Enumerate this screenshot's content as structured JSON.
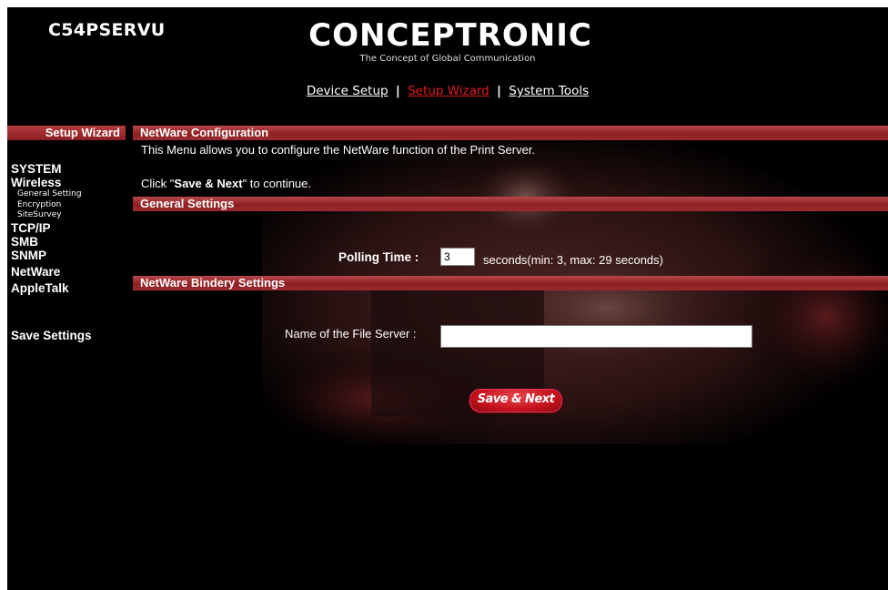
{
  "header": {
    "model": "C54PSERVU",
    "brand": "CONCEPTRONIC",
    "tagline": "The Concept of Global Communication",
    "nav": [
      {
        "label": "Device Setup",
        "active": false
      },
      {
        "label": "Setup Wizard",
        "active": true
      },
      {
        "label": "System Tools",
        "active": false
      }
    ],
    "nav_separator": "|"
  },
  "sidebar": {
    "title": "Setup Wizard",
    "items": [
      {
        "label": "SYSTEM"
      },
      {
        "label": "Wireless",
        "sub": [
          "General Setting",
          "Encryption",
          "SiteSurvey"
        ]
      },
      {
        "label": "TCP/IP"
      },
      {
        "label": "SMB"
      },
      {
        "label": "SNMP"
      },
      {
        "label": "NetWare"
      },
      {
        "label": "AppleTalk"
      }
    ],
    "save": "Save Settings"
  },
  "main": {
    "section_title": "NetWare Configuration",
    "description": "This Menu allows you to configure the NetWare function of the Print Server.",
    "instruction_prefix": "Click \"",
    "instruction_bold": "Save & Next",
    "instruction_suffix": "\" to continue.",
    "general": {
      "title": "General Settings",
      "polling_label": "Polling Time :",
      "polling_value": "3",
      "polling_hint": "seconds(min: 3, max: 29 seconds)"
    },
    "bindery": {
      "title": "NetWare Bindery Settings",
      "file_server_label": "Name of the File Server :",
      "file_server_value": ""
    },
    "save_next_label": "Save & Next"
  },
  "colors": {
    "background": "#000000",
    "bar": "#9a2a2e",
    "active_link": "#e31919"
  }
}
